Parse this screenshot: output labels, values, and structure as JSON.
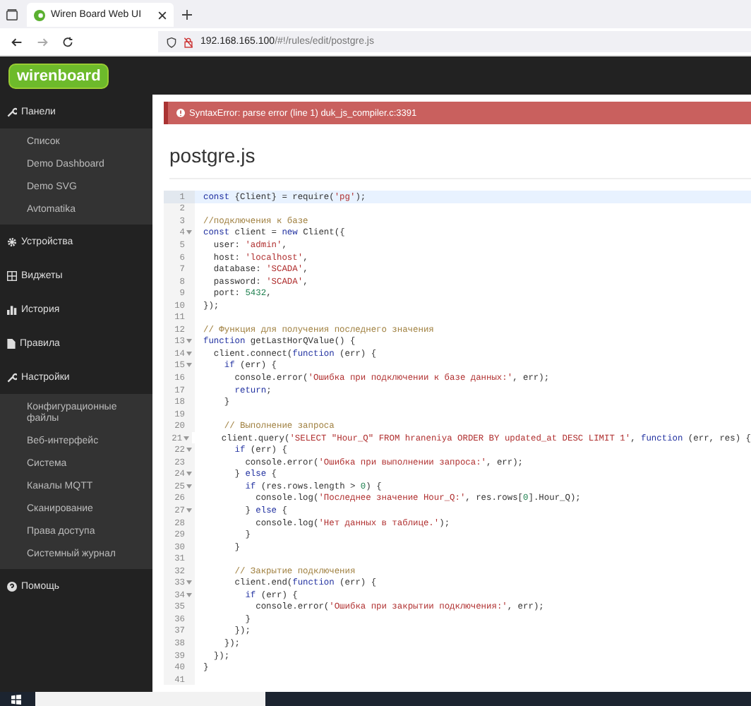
{
  "browser": {
    "tab_title": "Wiren Board Web UI",
    "url_host": "192.168.165.100",
    "url_path": "/#!/rules/edit/postgre.js"
  },
  "app": {
    "logo": "wirenboard"
  },
  "sidebar": [
    {
      "label": "Панели",
      "expanded": true,
      "children": [
        {
          "label": "Список"
        },
        {
          "label": "Demo Dashboard"
        },
        {
          "label": "Demo SVG"
        },
        {
          "label": "Avtomatika"
        }
      ]
    },
    {
      "label": "Устройства"
    },
    {
      "label": "Виджеты"
    },
    {
      "label": "История"
    },
    {
      "label": "Правила"
    },
    {
      "label": "Настройки",
      "expanded": true,
      "children": [
        {
          "label": "Конфигурационные файлы"
        },
        {
          "label": "Веб-интерфейс"
        },
        {
          "label": "Система"
        },
        {
          "label": "Каналы MQTT"
        },
        {
          "label": "Сканирование"
        },
        {
          "label": "Права доступа"
        },
        {
          "label": "Системный журнал"
        }
      ]
    },
    {
      "label": "Помощь"
    }
  ],
  "error": "SyntaxError: parse error (line 1) duk_js_compiler.c:3391",
  "title": "postgre.js",
  "code": [
    {
      "n": "1",
      "text": "const {Client} = require('pg');",
      "fold": false,
      "selected": true
    },
    {
      "n": "2",
      "fold": false,
      "selected": false
    },
    {
      "n": "3",
      "text": "//подключения к базе",
      "fold": false,
      "selected": false
    },
    {
      "n": "4",
      "text": "const client = new Client({",
      "fold": true,
      "selected": false
    },
    {
      "n": "5",
      "text": "  user: 'admin',",
      "fold": false,
      "selected": false
    },
    {
      "n": "6",
      "text": "  host: 'localhost',",
      "fold": false,
      "selected": false
    },
    {
      "n": "7",
      "text": "  database: 'SCADA',",
      "fold": false,
      "selected": false
    },
    {
      "n": "8",
      "text": "  password: 'SCADA',",
      "fold": false,
      "selected": false
    },
    {
      "n": "9",
      "text": "  port: 5432,",
      "fold": false,
      "selected": false
    },
    {
      "n": "10",
      "text": "});",
      "fold": false,
      "selected": false
    },
    {
      "n": "11",
      "fold": false,
      "selected": false
    },
    {
      "n": "12",
      "text": "// Функция для получения последнего значения",
      "fold": false,
      "selected": false
    },
    {
      "n": "13",
      "text": "function getLastHorQValue() {",
      "fold": true,
      "selected": false
    },
    {
      "n": "14",
      "text": "  client.connect(function (err) {",
      "fold": true,
      "selected": false
    },
    {
      "n": "15",
      "text": "    if (err) {",
      "fold": true,
      "selected": false
    },
    {
      "n": "16",
      "text": "      console.error('Ошибка при подключении к базе данных:', err);",
      "fold": false,
      "selected": false
    },
    {
      "n": "17",
      "text": "      return;",
      "fold": false,
      "selected": false
    },
    {
      "n": "18",
      "text": "    }",
      "fold": false,
      "selected": false
    },
    {
      "n": "19",
      "fold": false,
      "selected": false
    },
    {
      "n": "20",
      "text": "    // Выполнение запроса",
      "fold": false,
      "selected": false
    },
    {
      "n": "21",
      "text": "    client.query('SELECT \"Hour_Q\" FROM hraneniya ORDER BY updated_at DESC LIMIT 1', function (err, res) {",
      "fold": true,
      "selected": false
    },
    {
      "n": "22",
      "text": "      if (err) {",
      "fold": true,
      "selected": false
    },
    {
      "n": "23",
      "text": "        console.error('Ошибка при выполнении запроса:', err);",
      "fold": false,
      "selected": false
    },
    {
      "n": "24",
      "text": "      } else {",
      "fold": true,
      "selected": false
    },
    {
      "n": "25",
      "text": "        if (res.rows.length > 0) {",
      "fold": true,
      "selected": false
    },
    {
      "n": "26",
      "text": "          console.log('Последнее значение Hour_Q:', res.rows[0].Hour_Q);",
      "fold": false,
      "selected": false
    },
    {
      "n": "27",
      "text": "        } else {",
      "fold": true,
      "selected": false
    },
    {
      "n": "28",
      "text": "          console.log('Нет данных в таблице.');",
      "fold": false,
      "selected": false
    },
    {
      "n": "29",
      "text": "        }",
      "fold": false,
      "selected": false
    },
    {
      "n": "30",
      "text": "      }",
      "fold": false,
      "selected": false
    },
    {
      "n": "31",
      "fold": false,
      "selected": false
    },
    {
      "n": "32",
      "text": "      // Закрытие подключения",
      "fold": false,
      "selected": false
    },
    {
      "n": "33",
      "text": "      client.end(function (err) {",
      "fold": true,
      "selected": false
    },
    {
      "n": "34",
      "text": "        if (err) {",
      "fold": true,
      "selected": false
    },
    {
      "n": "35",
      "text": "          console.error('Ошибка при закрытии подключения:', err);",
      "fold": false,
      "selected": false
    },
    {
      "n": "36",
      "text": "        }",
      "fold": false,
      "selected": false
    },
    {
      "n": "37",
      "text": "      });",
      "fold": false,
      "selected": false
    },
    {
      "n": "38",
      "text": "    });",
      "fold": false,
      "selected": false
    },
    {
      "n": "39",
      "text": "  });",
      "fold": false,
      "selected": false
    },
    {
      "n": "40",
      "text": "}",
      "fold": false,
      "selected": false
    },
    {
      "n": "41",
      "fold": false,
      "selected": false
    }
  ]
}
